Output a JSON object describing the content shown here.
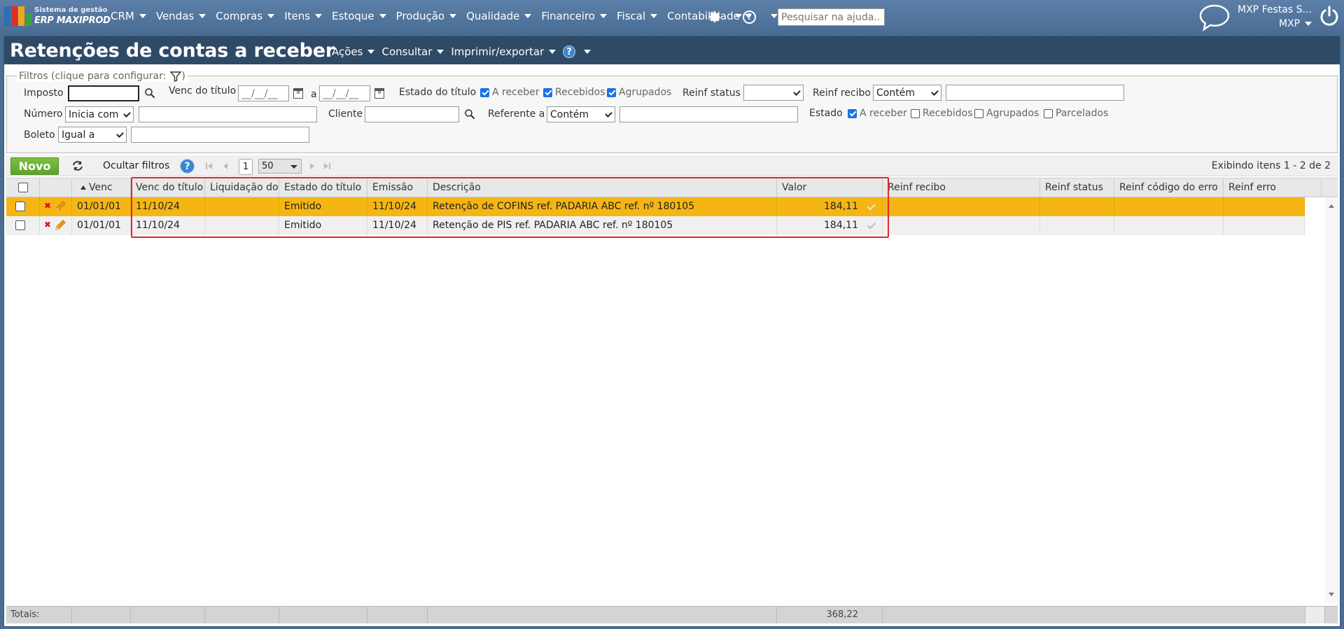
{
  "app": {
    "logo_line1": "Sistema de gestão",
    "logo_line2": "ERP MAXIPROD",
    "menu": [
      "CRM",
      "Vendas",
      "Compras",
      "Itens",
      "Estoque",
      "Produção",
      "Qualidade",
      "Financeiro",
      "Fiscal",
      "Contabilidade"
    ],
    "help_placeholder": "Pesquisar na ajuda...",
    "user_name": "MXP Festas S...",
    "company": "MXP"
  },
  "page": {
    "title": "Retenções de contas a receber",
    "menu": [
      "Ações",
      "Consultar",
      "Imprimir/exportar"
    ]
  },
  "filters": {
    "legend": "Filtros (clique para configurar:",
    "legend_close": ")",
    "imposto_label": "Imposto",
    "venc_titulo_label": "Venc do título",
    "date_placeholder": "__/__/__",
    "a_label": "a",
    "estado_titulo_label": "Estado do título",
    "estado_titulo_options": [
      {
        "label": "A receber",
        "checked": true
      },
      {
        "label": "Recebidos",
        "checked": true
      },
      {
        "label": "Agrupados",
        "checked": true
      }
    ],
    "reinf_status_label": "Reinf status",
    "reinf_status_value": "",
    "reinf_recibo_label": "Reinf recibo",
    "reinf_recibo_mode": "Contém",
    "numero_label": "Número",
    "numero_mode": "Inicia com",
    "cliente_label": "Cliente",
    "referente_label": "Referente a",
    "referente_mode": "Contém",
    "estado_label": "Estado",
    "estado_options": [
      {
        "label": "A receber",
        "checked": true
      },
      {
        "label": "Recebidos",
        "checked": false
      },
      {
        "label": "Agrupados",
        "checked": false
      },
      {
        "label": "Parcelados",
        "checked": false
      }
    ],
    "boleto_label": "Boleto",
    "boleto_mode": "Igual a"
  },
  "toolbar": {
    "new_label": "Novo",
    "hide_filters_label": "Ocultar filtros",
    "page_number": "1",
    "page_size": "50",
    "items_info": "Exibindo itens 1 - 2 de 2"
  },
  "grid": {
    "columns": [
      "Venc",
      "Venc do título",
      "Liquidação do",
      "Estado do título",
      "Emissão",
      "Descrição",
      "Valor",
      "Reinf recibo",
      "Reinf status",
      "Reinf código do erro",
      "Reinf erro"
    ],
    "rows": [
      {
        "venc": "01/01/01",
        "venc_titulo": "11/10/24",
        "liquidacao": "",
        "estado": "Emitido",
        "emissao": "11/10/24",
        "descricao": "Retenção de COFINS ref. PADARIA ABC ref. nº 180105",
        "valor": "184,11",
        "selected": true
      },
      {
        "venc": "01/01/01",
        "venc_titulo": "11/10/24",
        "liquidacao": "",
        "estado": "Emitido",
        "emissao": "11/10/24",
        "descricao": "Retenção de PIS ref. PADARIA ABC ref. nº 180105",
        "valor": "184,11",
        "selected": false
      }
    ],
    "totals_label": "Totais:",
    "totals_valor": "368,22"
  },
  "colors": {
    "topbar": "#4a6d94",
    "titlebar": "#2f4a66",
    "selected_row": "#f5b614",
    "new_button": "#6cb336",
    "highlight": "#e0282f"
  }
}
